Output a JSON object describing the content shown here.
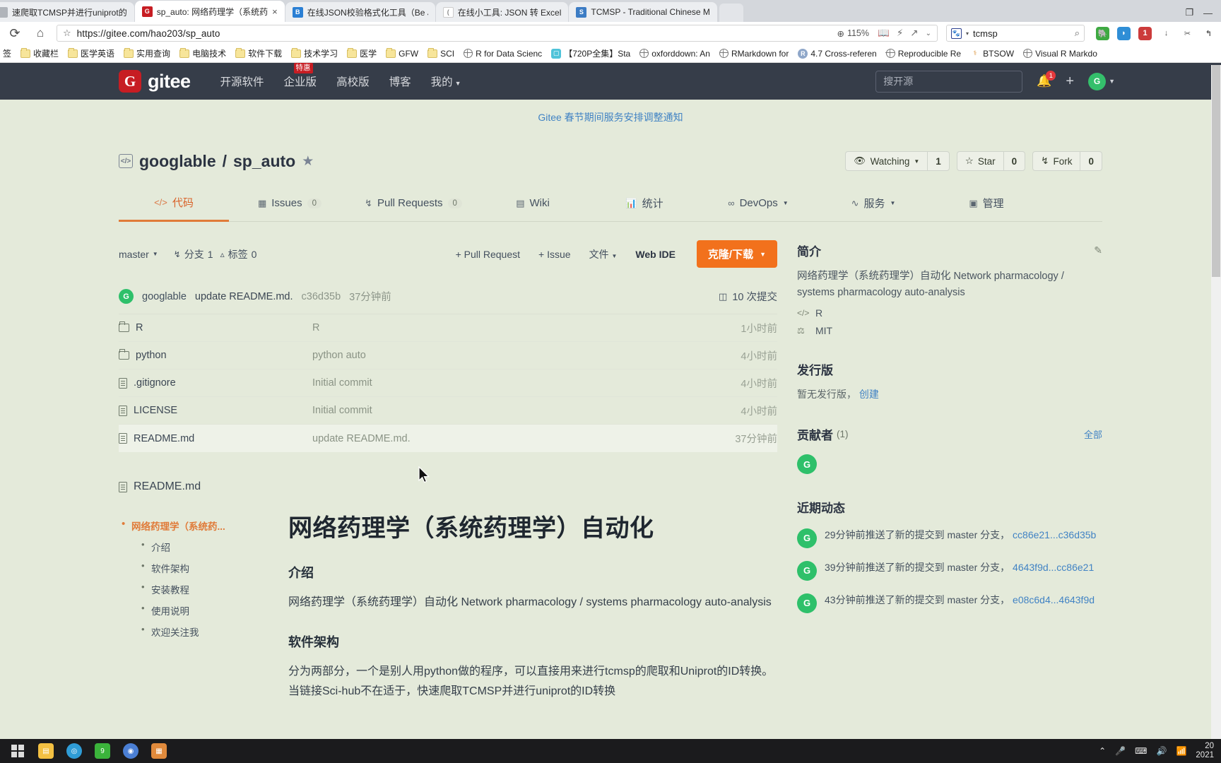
{
  "browser": {
    "tabs": [
      {
        "title": "速爬取TCMSP并进行uniprot的",
        "favicon": "blank-icon",
        "favicon_color": "#b0b4ba",
        "favicon_letter": "",
        "active": false
      },
      {
        "title": "sp_auto: 网络药理学（系统药理",
        "favicon": "gitee-icon",
        "favicon_color": "#c71d23",
        "favicon_letter": "G",
        "active": true
      },
      {
        "title": "在线JSON校验格式化工具（Be J",
        "favicon": "json-icon",
        "favicon_color": "#2a7fd4",
        "favicon_letter": "B",
        "active": false
      },
      {
        "title": "在线小工具: JSON 转 Excel",
        "favicon": "tool-icon",
        "favicon_color": "#ffffff",
        "favicon_letter": "",
        "active": false
      },
      {
        "title": "TCMSP - Traditional Chinese M",
        "favicon": "tcmsp-icon",
        "favicon_color": "#3c7cc4",
        "favicon_letter": "S",
        "active": false
      }
    ],
    "tab_close_label": "×",
    "window_controls": {
      "restore": "❐",
      "minimize": "—",
      "close": "✕"
    },
    "nav": {
      "reload": "⟳",
      "home": "⌂"
    },
    "url": "https://gitee.com/hao203/sp_auto",
    "url_star": "☆",
    "zoom_level": "115%",
    "toolbar_icons": [
      "reader-mode-icon",
      "lightning-icon",
      "share-icon",
      "chevron-down-icon"
    ],
    "search": {
      "engine": "baidu-icon",
      "value": "tcmsp",
      "icon": "search-icon"
    },
    "extensions": [
      {
        "name": "evernote-icon",
        "color": "#3ea942",
        "letter": ""
      },
      {
        "name": "pocket-icon",
        "color": "#2f8ed6",
        "letter": ""
      },
      {
        "name": "notes-icon",
        "color": "#cc3b3b",
        "letter": "1"
      },
      {
        "name": "download-icon",
        "color": "transparent",
        "letter": "↓"
      },
      {
        "name": "scissors-icon",
        "color": "transparent",
        "letter": "✂"
      },
      {
        "name": "undo-icon",
        "color": "transparent",
        "letter": "↰"
      }
    ],
    "bookmarks": [
      {
        "label": "签",
        "icon": "partial-icon"
      },
      {
        "label": "收藏栏",
        "icon": "folder-icon"
      },
      {
        "label": "医学英语",
        "icon": "folder-icon"
      },
      {
        "label": "实用查询",
        "icon": "folder-icon"
      },
      {
        "label": "电脑技术",
        "icon": "folder-icon"
      },
      {
        "label": "软件下载",
        "icon": "folder-icon"
      },
      {
        "label": "技术学习",
        "icon": "folder-icon"
      },
      {
        "label": "医学",
        "icon": "folder-icon"
      },
      {
        "label": "GFW",
        "icon": "folder-icon"
      },
      {
        "label": "SCI",
        "icon": "folder-icon"
      },
      {
        "label": "R for Data Scienc",
        "icon": "globe-icon"
      },
      {
        "label": "【720P全集】Sta",
        "icon": "video-icon"
      },
      {
        "label": "oxforddown: An",
        "icon": "globe-icon"
      },
      {
        "label": "RMarkdown for",
        "icon": "globe-icon"
      },
      {
        "label": "4.7 Cross-referen",
        "icon": "r-icon"
      },
      {
        "label": "Reproducible Re",
        "icon": "globe-icon"
      },
      {
        "label": "BTSOW",
        "icon": "magnet-icon"
      },
      {
        "label": "Visual R Markdo",
        "icon": "globe-icon"
      }
    ]
  },
  "gitee": {
    "logo_mark": "G",
    "logo_word": "gitee",
    "nav": [
      {
        "label": "开源软件",
        "badge": ""
      },
      {
        "label": "企业版",
        "badge": "特惠"
      },
      {
        "label": "高校版",
        "badge": ""
      },
      {
        "label": "博客",
        "badge": ""
      },
      {
        "label": "我的",
        "badge": "",
        "caret": true
      }
    ],
    "search_placeholder": "搜开源",
    "notification_count": "1",
    "plus_label": "+",
    "avatar_letter": "G",
    "notice": "Gitee 春节期间服务安排调整通知"
  },
  "repo": {
    "owner": "googlable",
    "separator": "/",
    "name": "sp_auto",
    "badge_icon": "medal-icon",
    "actions": [
      {
        "name": "watch",
        "icon": "eye-icon",
        "label": "Watching",
        "caret": true,
        "count": "1"
      },
      {
        "name": "star",
        "icon": "star-icon",
        "label": "Star",
        "caret": false,
        "count": "0"
      },
      {
        "name": "fork",
        "icon": "fork-icon",
        "label": "Fork",
        "caret": false,
        "count": "0"
      }
    ],
    "tabs": [
      {
        "label": "代码",
        "icon": "code-icon",
        "count": "",
        "active": true,
        "caret": false
      },
      {
        "label": "Issues",
        "icon": "issues-icon",
        "count": "0",
        "active": false,
        "caret": false
      },
      {
        "label": "Pull Requests",
        "icon": "pr-icon",
        "count": "0",
        "active": false,
        "caret": false
      },
      {
        "label": "Wiki",
        "icon": "wiki-icon",
        "count": "",
        "active": false,
        "caret": false
      },
      {
        "label": "统计",
        "icon": "chart-icon",
        "count": "",
        "active": false,
        "caret": false
      },
      {
        "label": "DevOps",
        "icon": "infinity-icon",
        "count": "",
        "active": false,
        "caret": true
      },
      {
        "label": "服务",
        "icon": "pulse-icon",
        "count": "",
        "active": false,
        "caret": true
      },
      {
        "label": "管理",
        "icon": "manage-icon",
        "count": "",
        "active": false,
        "caret": false
      }
    ]
  },
  "toolbar": {
    "branch": "master",
    "branches_icon": "branch-icon",
    "branches_label": "分支",
    "branches_count": "1",
    "tags_icon": "tag-icon",
    "tags_label": "标签",
    "tags_count": "0",
    "pull_request": "+ Pull Request",
    "issue": "+ Issue",
    "files": "文件",
    "web_ide": "Web IDE",
    "clone": "克隆/下载"
  },
  "commit": {
    "avatar_letter": "G",
    "author": "googlable",
    "message": "update README.md.",
    "sha": "c36d35b",
    "time": "37分钟前",
    "count_icon": "history-icon",
    "count_label": "10 次提交"
  },
  "files": [
    {
      "name": "R",
      "type": "folder",
      "message": "R",
      "time": "1小时前",
      "highlight": false
    },
    {
      "name": "python",
      "type": "folder",
      "message": "python auto",
      "time": "4小时前",
      "highlight": false
    },
    {
      "name": ".gitignore",
      "type": "file",
      "message": "Initial commit",
      "time": "4小时前",
      "highlight": false
    },
    {
      "name": "LICENSE",
      "type": "file",
      "message": "Initial commit",
      "time": "4小时前",
      "highlight": false
    },
    {
      "name": "README.md",
      "type": "file",
      "message": "update README.md.",
      "time": "37分钟前",
      "highlight": true
    }
  ],
  "readme": {
    "header": "README.md",
    "toc": [
      {
        "label": "网络药理学（系统药...",
        "level": 1
      },
      {
        "label": "介绍",
        "level": 2
      },
      {
        "label": "软件架构",
        "level": 2
      },
      {
        "label": "安装教程",
        "level": 2
      },
      {
        "label": "使用说明",
        "level": 2
      },
      {
        "label": "欢迎关注我",
        "level": 2
      }
    ],
    "h1": "网络药理学（系统药理学）自动化",
    "sections": [
      {
        "h2": "介绍",
        "p": "网络药理学（系统药理学）自动化 Network pharmacology / systems pharmacology auto-analysis"
      },
      {
        "h2": "软件架构",
        "p": "分为两部分，一个是别人用python做的程序，可以直接用来进行tcmsp的爬取和Uniprot的ID转换。当链接Sci-hub不在适于，快速爬取TCMSP并进行uniprot的ID转换"
      }
    ]
  },
  "sidebar": {
    "intro": {
      "title": "简介",
      "edit_icon": "edit-icon",
      "desc": "网络药理学（系统药理学）自动化 Network pharmacology / systems pharmacology auto-analysis",
      "language_icon": "code-icon",
      "language": "R",
      "license_icon": "license-icon",
      "license": "MIT"
    },
    "releases": {
      "title": "发行版",
      "empty": "暂无发行版，",
      "create": "创建"
    },
    "contributors": {
      "title": "贡献者",
      "count": "(1)",
      "all": "全部",
      "avatars": [
        {
          "letter": "G"
        }
      ]
    },
    "activity": {
      "title": "近期动态",
      "items": [
        {
          "avatar": "G",
          "text": "29分钟前推送了新的提交到 master 分支，",
          "link": "cc86e21...c36d35b"
        },
        {
          "avatar": "G",
          "text": "39分钟前推送了新的提交到 master 分支，",
          "link": "4643f9d...cc86e21"
        },
        {
          "avatar": "G",
          "text": "43分钟前推送了新的提交到 master 分支，",
          "link": "e08c6d4...4643f9d"
        }
      ]
    }
  },
  "taskbar": {
    "start_icon": "windows-icon",
    "items": [
      {
        "name": "file-explorer-icon",
        "color": "#f3c042",
        "letter": ""
      },
      {
        "name": "browser-icon",
        "color": "#2f9cd6",
        "letter": ""
      },
      {
        "name": "wechat-icon",
        "color": "#3bb33b",
        "letter": "9"
      },
      {
        "name": "media-icon",
        "color": "#4b7fd4",
        "letter": ""
      },
      {
        "name": "app-icon",
        "color": "#e08a3c",
        "letter": ""
      }
    ],
    "tray": [
      "chevron-up-icon",
      "mic-icon",
      "keyboard-icon",
      "volume-icon",
      "network-icon"
    ],
    "clock_line1": "20",
    "clock_line2": "2021"
  }
}
